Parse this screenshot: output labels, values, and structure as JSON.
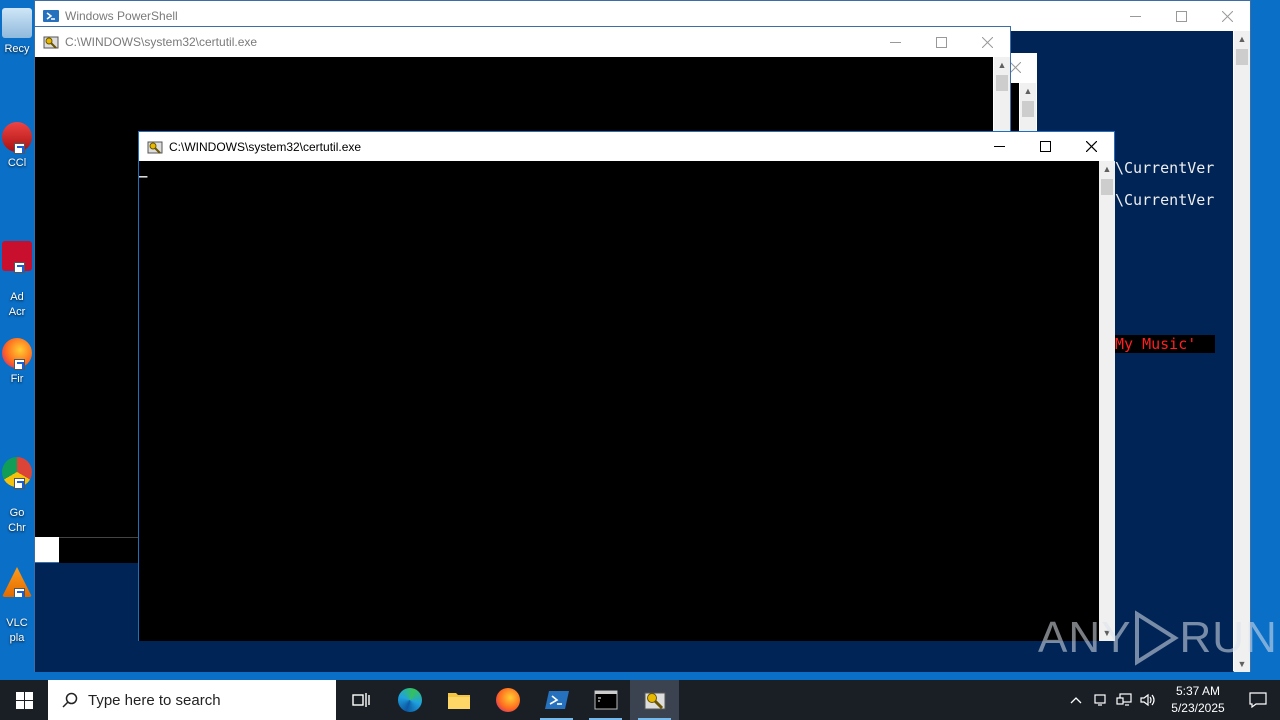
{
  "desktop": {
    "icons": [
      {
        "label": "Recy",
        "icon": "recycle-bin-icon"
      },
      {
        "label": "CCl",
        "icon": "ccleaner-icon"
      },
      {
        "label": "Ad\nAcr",
        "icon": "adobe-acrobat-icon"
      },
      {
        "label": "Fir",
        "icon": "firefox-icon"
      },
      {
        "label": "Go\nChr",
        "icon": "chrome-icon"
      },
      {
        "label": "VLC\npla",
        "icon": "vlc-icon"
      }
    ]
  },
  "powershell": {
    "title": "Windows PowerShell",
    "lines": [
      "\\CurrentVer",
      "\\CurrentVer"
    ],
    "error_text": "My Music'"
  },
  "certutil_back": {
    "title": "C:\\WINDOWS\\system32\\certutil.exe"
  },
  "certutil_front": {
    "title": "C:\\WINDOWS\\system32\\certutil.exe",
    "cursor": "_"
  },
  "taskbar": {
    "search_placeholder": "Type here to search",
    "apps": [
      {
        "name": "task-view",
        "icon": "task-view-icon"
      },
      {
        "name": "edge",
        "icon": "edge-icon"
      },
      {
        "name": "file-explorer",
        "icon": "folder-icon"
      },
      {
        "name": "firefox",
        "icon": "firefox-icon"
      },
      {
        "name": "powershell",
        "icon": "powershell-icon",
        "open": true
      },
      {
        "name": "cmd",
        "icon": "terminal-icon",
        "open": true
      },
      {
        "name": "certutil",
        "icon": "certutil-icon",
        "open": true,
        "active": true
      }
    ],
    "time": "5:37 AM",
    "date": "5/23/2025"
  },
  "watermark": {
    "text_left": "ANY",
    "text_right": "RUN"
  },
  "colors": {
    "desktop": "#0a6fc7",
    "powershell_bg": "#012456",
    "console_bg": "#000000",
    "error_fg": "#ff2020",
    "taskbar": "#1a1f26"
  }
}
